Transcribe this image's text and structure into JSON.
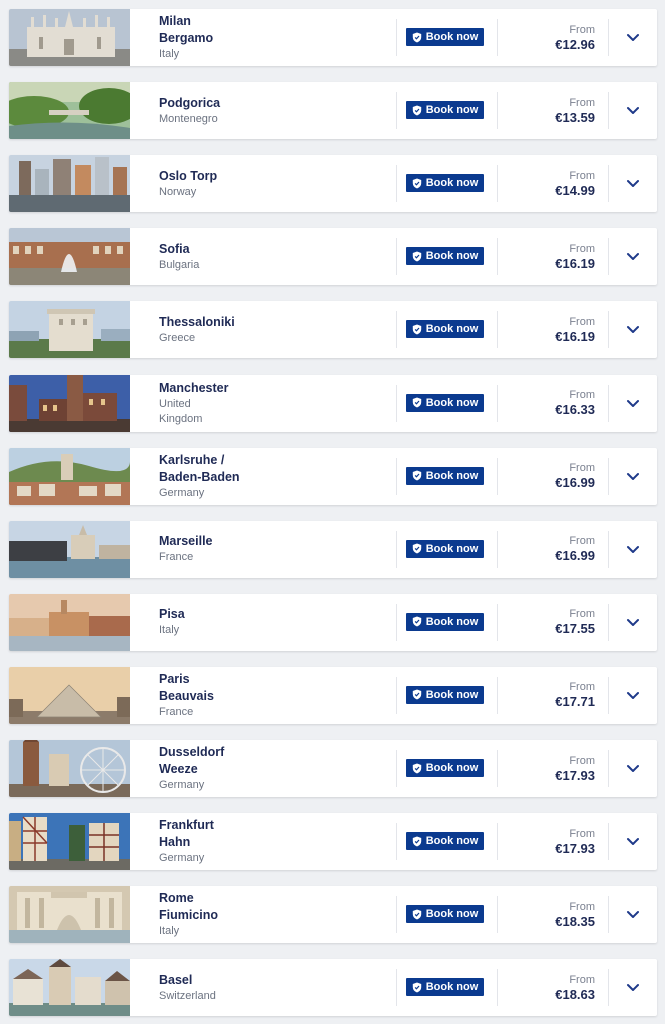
{
  "colors": {
    "accent": "#0b3a8f",
    "text_primary": "#1f2a55",
    "text_muted": "#6b7280"
  },
  "destinations": [
    {
      "city": "Milan\nBergamo",
      "country": "Italy",
      "from": "From",
      "price": "€12.96",
      "book": "Book now",
      "scene": "cathedral"
    },
    {
      "city": "Podgorica",
      "country": "Montenegro",
      "from": "From",
      "price": "€13.59",
      "book": "Book now",
      "scene": "river"
    },
    {
      "city": "Oslo Torp",
      "country": "Norway",
      "from": "From",
      "price": "€14.99",
      "book": "Book now",
      "scene": "harbor"
    },
    {
      "city": "Sofia",
      "country": "Bulgaria",
      "from": "From",
      "price": "€16.19",
      "book": "Book now",
      "scene": "fountain"
    },
    {
      "city": "Thessaloniki",
      "country": "Greece",
      "from": "From",
      "price": "€16.19",
      "book": "Book now",
      "scene": "tower"
    },
    {
      "city": "Manchester",
      "country": "United\nKingdom",
      "from": "From",
      "price": "€16.33",
      "book": "Book now",
      "scene": "townhall"
    },
    {
      "city": "Karlsruhe /\nBaden-Baden",
      "country": "Germany",
      "from": "From",
      "price": "€16.99",
      "book": "Book now",
      "scene": "hills"
    },
    {
      "city": "Marseille",
      "country": "France",
      "from": "From",
      "price": "€16.99",
      "book": "Book now",
      "scene": "waterfront"
    },
    {
      "city": "Pisa",
      "country": "Italy",
      "from": "From",
      "price": "€17.55",
      "book": "Book now",
      "scene": "riverbank"
    },
    {
      "city": "Paris\nBeauvais",
      "country": "France",
      "from": "From",
      "price": "€17.71",
      "book": "Book now",
      "scene": "pyramid"
    },
    {
      "city": "Dusseldorf\nWeeze",
      "country": "Germany",
      "from": "From",
      "price": "€17.93",
      "book": "Book now",
      "scene": "wheel"
    },
    {
      "city": "Frankfurt\nHahn",
      "country": "Germany",
      "from": "From",
      "price": "€17.93",
      "book": "Book now",
      "scene": "timber"
    },
    {
      "city": "Rome\nFiumicino",
      "country": "Italy",
      "from": "From",
      "price": "€18.35",
      "book": "Book now",
      "scene": "fountain-trevi"
    },
    {
      "city": "Basel",
      "country": "Switzerland",
      "from": "From",
      "price": "€18.63",
      "book": "Book now",
      "scene": "riverside-town"
    }
  ]
}
